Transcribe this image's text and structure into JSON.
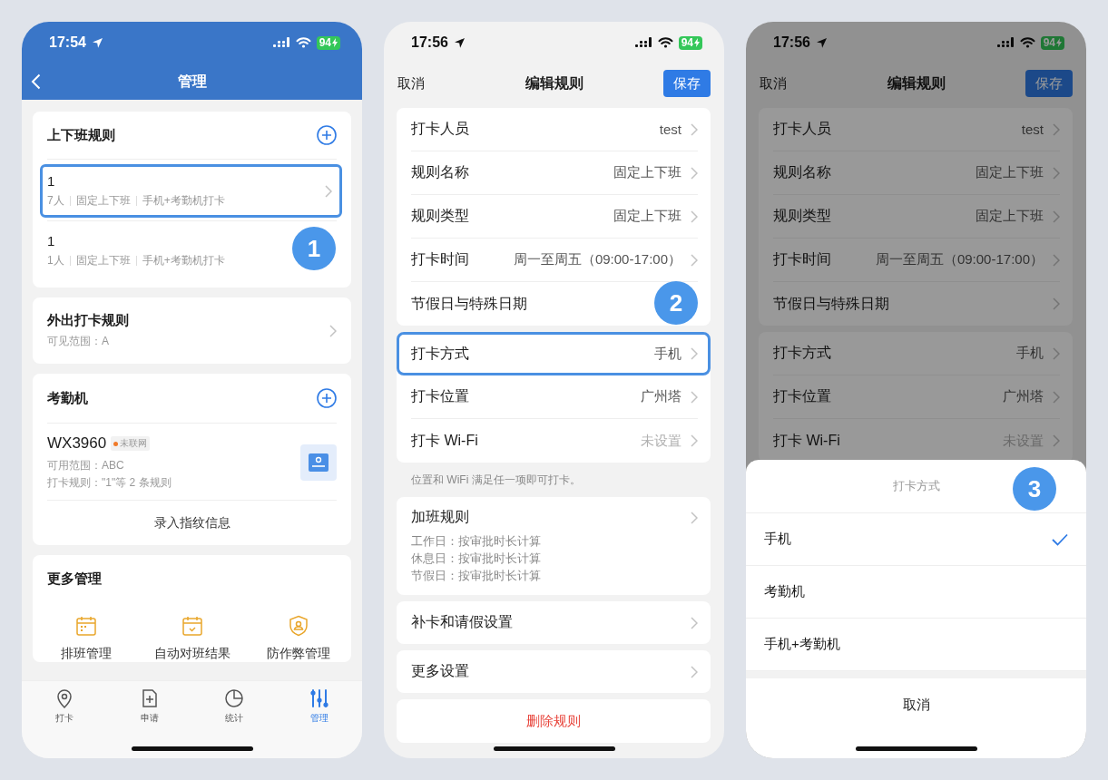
{
  "screens": [
    {
      "kind": "management",
      "status": {
        "time": "17:54",
        "battery": "94"
      },
      "nav": {
        "title": "管理"
      },
      "cards": [
        {
          "kind": "rules",
          "title": "上下班规则",
          "rules": [
            {
              "name": "1",
              "meta": [
                "7人",
                "固定上下班",
                "手机+考勤机打卡"
              ],
              "highlighted": true
            },
            {
              "name": "1",
              "meta": [
                "1人",
                "固定上下班",
                "手机+考勤机打卡"
              ],
              "highlighted": false,
              "callout": "1"
            }
          ]
        },
        {
          "kind": "link",
          "title": "外出打卡规则",
          "subtitle": "可见范围：A"
        },
        {
          "kind": "devices",
          "title": "考勤机",
          "device": {
            "name": "WX3960",
            "status": "未联网",
            "online": false,
            "lines": [
              "可用范围：ABC",
              "打卡规则：\"1\"等 2 条规则"
            ]
          },
          "action": "录入指纹信息"
        },
        {
          "kind": "grid",
          "title": "更多管理",
          "items": [
            "排班管理",
            "自动对班结果",
            "防作弊管理"
          ]
        }
      ],
      "tabs": [
        {
          "label": "打卡",
          "selected": false
        },
        {
          "label": "申请",
          "selected": false
        },
        {
          "label": "统计",
          "selected": false
        },
        {
          "label": "管理",
          "selected": true
        }
      ]
    },
    {
      "kind": "rule_editor",
      "status": {
        "time": "17:56",
        "battery": "94"
      },
      "nav": {
        "cancel": "取消",
        "title": "编辑规则",
        "save": "保存"
      },
      "sections": [
        {
          "kind": "group",
          "rows": [
            {
              "label": "打卡人员",
              "value": "test",
              "muted": false,
              "highlighted": false
            },
            {
              "label": "规则名称",
              "value": "固定上下班",
              "muted": false,
              "highlighted": false
            },
            {
              "label": "规则类型",
              "value": "固定上下班",
              "muted": false,
              "highlighted": false
            },
            {
              "label": "打卡时间",
              "value": "周一至周五（09:00-17:00）",
              "muted": false,
              "highlighted": false
            },
            {
              "label": "节假日与特殊日期",
              "highlighted": false,
              "callout": "2"
            }
          ]
        },
        {
          "kind": "group",
          "rows": [
            {
              "label": "打卡方式",
              "value": "手机",
              "muted": false,
              "highlighted": true
            },
            {
              "label": "打卡位置",
              "value": "广州塔",
              "muted": false,
              "highlighted": false
            },
            {
              "label": "打卡 Wi-Fi",
              "value": "未设置",
              "muted": true,
              "highlighted": false
            }
          ]
        },
        {
          "kind": "note",
          "text": "位置和 WiFi 满足任一项即可打卡。"
        },
        {
          "kind": "detail",
          "title": "加班规则",
          "lines": [
            "工作日：按审批时长计算",
            "休息日：按审批时长计算",
            "节假日：按审批时长计算"
          ]
        },
        {
          "kind": "link",
          "title": "补卡和请假设置"
        },
        {
          "kind": "link",
          "title": "更多设置"
        },
        {
          "kind": "danger",
          "title": "删除规则"
        }
      ]
    },
    {
      "kind": "rule_editor",
      "dimmed": true,
      "status": {
        "time": "17:56",
        "battery": "94"
      },
      "nav": {
        "cancel": "取消",
        "title": "编辑规则",
        "save": "保存"
      },
      "sections": [
        {
          "kind": "group",
          "rows": [
            {
              "label": "打卡人员",
              "value": "test",
              "muted": false,
              "highlighted": false
            },
            {
              "label": "规则名称",
              "value": "固定上下班",
              "muted": false,
              "highlighted": false
            },
            {
              "label": "规则类型",
              "value": "固定上下班",
              "muted": false,
              "highlighted": false
            },
            {
              "label": "打卡时间",
              "value": "周一至周五（09:00-17:00）",
              "muted": false,
              "highlighted": false
            },
            {
              "label": "节假日与特殊日期",
              "highlighted": false
            }
          ]
        },
        {
          "kind": "group",
          "rows": [
            {
              "label": "打卡方式",
              "value": "手机",
              "muted": false,
              "highlighted": false
            },
            {
              "label": "打卡位置",
              "value": "广州塔",
              "muted": false,
              "highlighted": false
            },
            {
              "label": "打卡 Wi-Fi",
              "value": "未设置",
              "muted": true,
              "highlighted": false
            }
          ]
        }
      ],
      "sheet": {
        "title": "打卡方式",
        "callout": "3",
        "options": [
          {
            "label": "手机",
            "selected": true
          },
          {
            "label": "考勤机",
            "selected": false
          },
          {
            "label": "手机+考勤机",
            "selected": false
          }
        ],
        "cancel": "取消"
      }
    }
  ]
}
